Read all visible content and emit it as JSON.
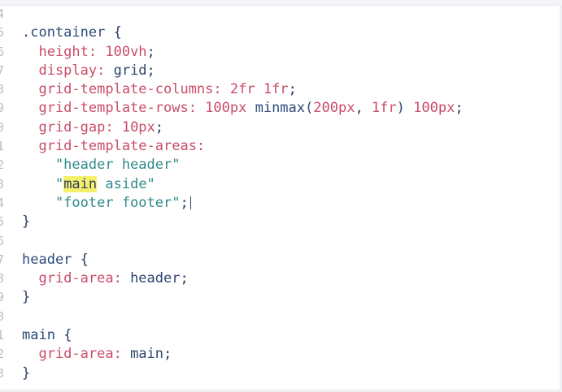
{
  "editor": {
    "lines": [
      {
        "n": "4",
        "tokens": []
      },
      {
        "n": "5",
        "tokens": [
          [
            "sel",
            ".container"
          ],
          [
            "punc",
            " {"
          ]
        ]
      },
      {
        "n": "6",
        "tokens": [
          [
            "prop",
            "  height:"
          ],
          [
            "num",
            " 100vh"
          ],
          [
            "punc",
            ";"
          ]
        ]
      },
      {
        "n": "7",
        "tokens": [
          [
            "prop",
            "  display:"
          ],
          [
            "kw",
            " grid"
          ],
          [
            "punc",
            ";"
          ]
        ]
      },
      {
        "n": "8",
        "tokens": [
          [
            "prop",
            "  grid-template-columns:"
          ],
          [
            "num",
            " 2fr 1fr"
          ],
          [
            "punc",
            ";"
          ]
        ]
      },
      {
        "n": "9",
        "tokens": [
          [
            "prop",
            "  grid-template-rows:"
          ],
          [
            "num",
            " 100px"
          ],
          [
            "fn",
            " minmax("
          ],
          [
            "num",
            "200px"
          ],
          [
            "punc",
            ", "
          ],
          [
            "num",
            "1fr"
          ],
          [
            "fn",
            ")"
          ],
          [
            "num",
            " 100px"
          ],
          [
            "punc",
            ";"
          ]
        ]
      },
      {
        "n": "0",
        "tokens": [
          [
            "prop",
            "  grid-gap:"
          ],
          [
            "num",
            " 10px"
          ],
          [
            "punc",
            ";"
          ]
        ]
      },
      {
        "n": "1",
        "tokens": [
          [
            "prop",
            "  grid-template-areas:"
          ]
        ]
      },
      {
        "n": "2",
        "tokens": [
          [
            "str",
            "    \"header header\""
          ]
        ]
      },
      {
        "n": "3",
        "tokens": [
          [
            "str",
            "    \""
          ],
          [
            "hl",
            "main"
          ],
          [
            "str",
            " aside\""
          ]
        ]
      },
      {
        "n": "4",
        "tokens": [
          [
            "str",
            "    \"footer footer\""
          ],
          [
            "punc",
            ";"
          ],
          [
            "cursor",
            ""
          ]
        ]
      },
      {
        "n": "5",
        "tokens": [
          [
            "punc",
            "}"
          ]
        ]
      },
      {
        "n": "6",
        "tokens": []
      },
      {
        "n": "7",
        "tokens": [
          [
            "sel",
            "header"
          ],
          [
            "punc",
            " {"
          ]
        ]
      },
      {
        "n": "8",
        "tokens": [
          [
            "prop",
            "  grid-area:"
          ],
          [
            "kw",
            " header"
          ],
          [
            "punc",
            ";"
          ]
        ]
      },
      {
        "n": "9",
        "tokens": [
          [
            "punc",
            "}"
          ]
        ]
      },
      {
        "n": "0",
        "tokens": []
      },
      {
        "n": "1",
        "tokens": [
          [
            "sel",
            "main"
          ],
          [
            "punc",
            " {"
          ]
        ]
      },
      {
        "n": "2",
        "tokens": [
          [
            "prop",
            "  grid-area:"
          ],
          [
            "kw",
            " main"
          ],
          [
            "punc",
            ";"
          ]
        ]
      },
      {
        "n": "3",
        "tokens": [
          [
            "punc",
            "}"
          ]
        ]
      }
    ]
  }
}
